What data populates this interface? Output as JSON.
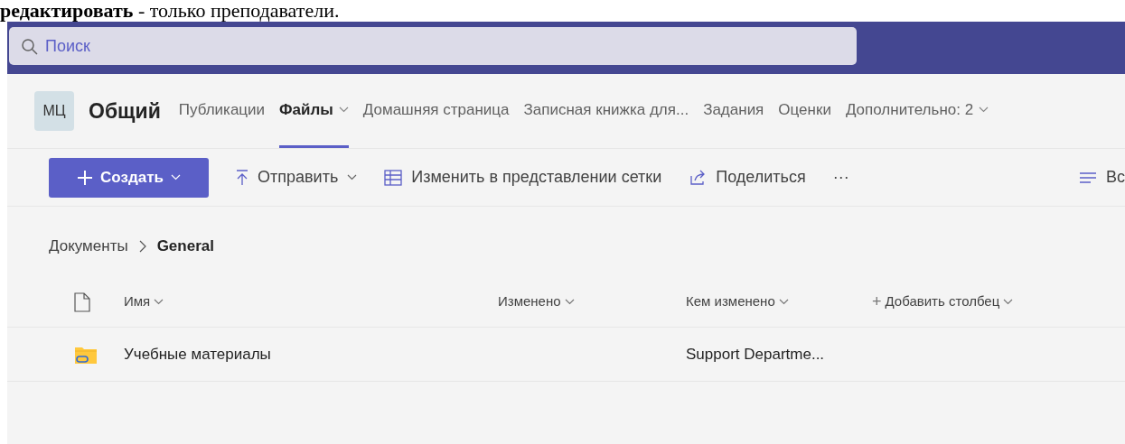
{
  "document_line": "**редактировать** - только преподаватели.",
  "search": {
    "placeholder": "Поиск"
  },
  "channel": {
    "avatar": "МЦ",
    "name": "Общий"
  },
  "tabs": [
    {
      "label": "Публикации",
      "selected": false,
      "dropdown": false
    },
    {
      "label": "Файлы",
      "selected": true,
      "dropdown": true
    },
    {
      "label": "Домашняя страница",
      "selected": false,
      "dropdown": false
    },
    {
      "label": "Записная книжка для...",
      "selected": false,
      "dropdown": false
    },
    {
      "label": "Задания",
      "selected": false,
      "dropdown": false
    },
    {
      "label": "Оценки",
      "selected": false,
      "dropdown": false
    },
    {
      "label": "Дополнительно: 2",
      "selected": false,
      "dropdown": true
    }
  ],
  "toolbar": [
    {
      "kind": "primary",
      "label": "Создать"
    },
    {
      "kind": "upload",
      "label": "Отправить"
    },
    {
      "kind": "grid",
      "label": "Изменить в представлении сетки"
    },
    {
      "kind": "share",
      "label": "Поделиться"
    },
    {
      "kind": "more",
      "label": "···"
    },
    {
      "kind": "view",
      "label": "Вс"
    }
  ],
  "breadcrumb": [
    {
      "label": "Документы",
      "current": false
    },
    {
      "label": "General",
      "current": true
    }
  ],
  "columns": [
    {
      "label": "Имя",
      "kind": "name"
    },
    {
      "label": "Изменено",
      "kind": "modified"
    },
    {
      "label": "Кем изменено",
      "kind": "modified_by"
    },
    {
      "label": "Добавить столбец",
      "kind": "add",
      "icon": "+"
    }
  ],
  "rows": [
    {
      "name": "Учебные материалы",
      "modified": "",
      "modified_by": "Support Departme..."
    }
  ]
}
